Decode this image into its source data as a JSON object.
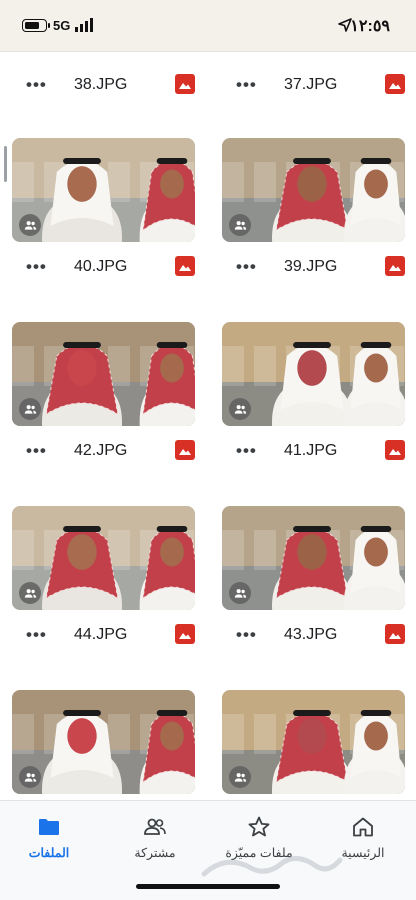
{
  "status_bar": {
    "network": "5G",
    "time": "١٢:٥٩",
    "battery_level": 0.8
  },
  "icons": {
    "more": "more-horizontal-icon",
    "file_type": "image-file-icon",
    "shared": "shared-people-icon"
  },
  "colors": {
    "file_icon": "#d93025",
    "active_nav": "#1a73e8"
  },
  "more_label": "•••",
  "top_files": [
    {
      "name": "38.JPG"
    },
    {
      "name": "37.JPG"
    }
  ],
  "grid_rows": [
    {
      "left": {
        "name": "40.JPG",
        "shared": true
      },
      "right": {
        "name": "39.JPG",
        "shared": true
      }
    },
    {
      "left": {
        "name": "42.JPG",
        "shared": true
      },
      "right": {
        "name": "41.JPG",
        "shared": true
      }
    },
    {
      "left": {
        "name": "44.JPG",
        "shared": true
      },
      "right": {
        "name": "43.JPG",
        "shared": true
      }
    },
    {
      "left": {
        "name": "",
        "shared": true
      },
      "right": {
        "name": "",
        "shared": true
      }
    }
  ],
  "bottom_nav": {
    "files": "الملفات",
    "shared": "مشتركة",
    "starred": "ملفات مميّزة",
    "home": "الرئيسية",
    "active": "files"
  }
}
